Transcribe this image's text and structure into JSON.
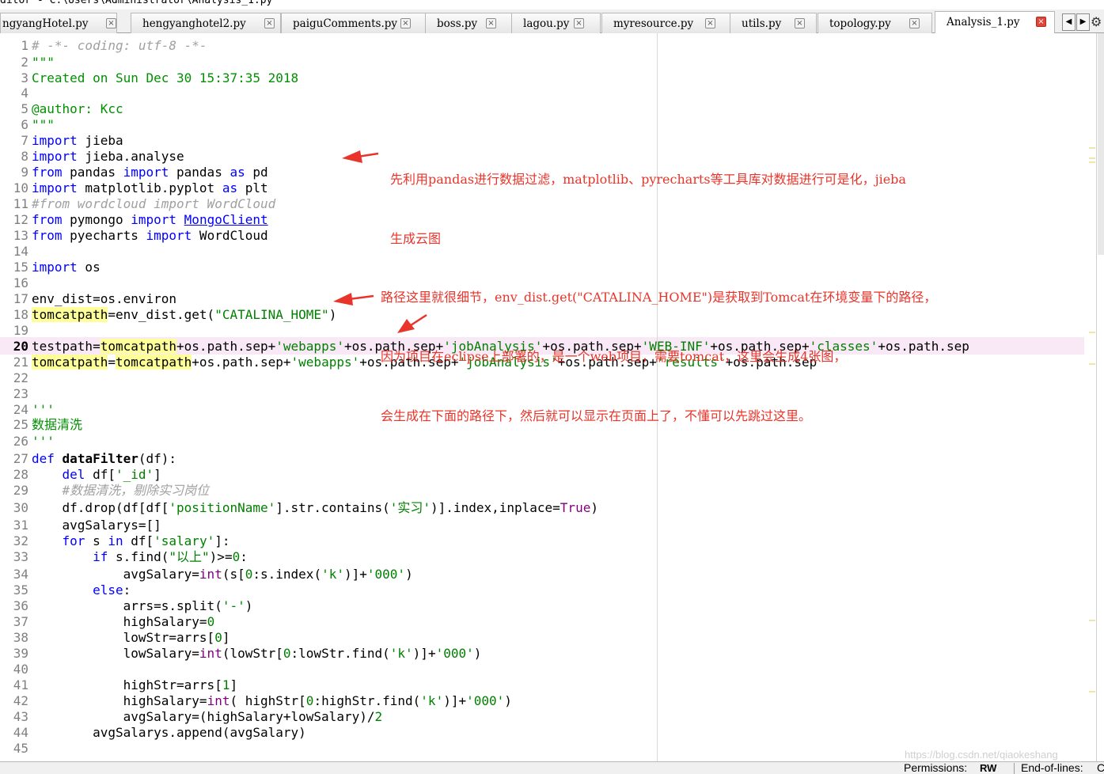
{
  "window": {
    "title": "ditor - C:\\Users\\Administrator\\Analysis_1.py"
  },
  "tabs": [
    {
      "label": "ngyangHotel.py"
    },
    {
      "label": "hengyanghotel2.py"
    },
    {
      "label": "paiguComments.py"
    },
    {
      "label": "boss.py"
    },
    {
      "label": "lagou.py"
    },
    {
      "label": "myresource.py"
    },
    {
      "label": "utils.py"
    },
    {
      "label": "topology.py"
    },
    {
      "label": "Analysis_1.py",
      "active": true
    }
  ],
  "tab_close_glyph": "×",
  "nav": {
    "left": "◀",
    "right": "▶",
    "settings": "⚙"
  },
  "editor": {
    "current_line": 20,
    "lines": [
      [
        [
          "c",
          "# -*- coding: utf-8 -*-"
        ]
      ],
      [
        [
          "sd",
          "\"\"\""
        ]
      ],
      [
        [
          "sd",
          "Created on Sun Dec 30 15:37:35 2018"
        ]
      ],
      [],
      [
        [
          "sd",
          "@author: Kcc"
        ]
      ],
      [
        [
          "sd",
          "\"\"\""
        ]
      ],
      [
        [
          "k",
          "import"
        ],
        [
          "n",
          " jieba"
        ]
      ],
      [
        [
          "k",
          "import"
        ],
        [
          "n",
          " jieba.analyse"
        ]
      ],
      [
        [
          "k",
          "from"
        ],
        [
          "n",
          " pandas "
        ],
        [
          "k",
          "import"
        ],
        [
          "n",
          " pandas "
        ],
        [
          "k",
          "as"
        ],
        [
          "n",
          " pd"
        ]
      ],
      [
        [
          "k",
          "import"
        ],
        [
          "n",
          " matplotlib.pyplot "
        ],
        [
          "k",
          "as"
        ],
        [
          "n",
          " plt"
        ]
      ],
      [
        [
          "c",
          "#from wordcloud import WordCloud"
        ]
      ],
      [
        [
          "k",
          "from"
        ],
        [
          "n",
          " pymongo "
        ],
        [
          "k",
          "import"
        ],
        [
          "n",
          " "
        ],
        [
          "u",
          "MongoClient"
        ]
      ],
      [
        [
          "k",
          "from"
        ],
        [
          "n",
          " pyecharts "
        ],
        [
          "k",
          "import"
        ],
        [
          "n",
          " WordCloud"
        ]
      ],
      [],
      [
        [
          "k",
          "import"
        ],
        [
          "n",
          " os"
        ]
      ],
      [],
      [
        [
          "n",
          "env_dist=os.environ"
        ]
      ],
      [
        [
          "hl",
          "tomcatpath"
        ],
        [
          "n",
          "=env_dist.get("
        ],
        [
          "s",
          "\"CATALINA_HOME\""
        ],
        [
          "n",
          ")"
        ]
      ],
      [],
      [
        [
          "n",
          "testpath="
        ],
        [
          "hl",
          "tomcatpath"
        ],
        [
          "n",
          "+os.path.sep+"
        ],
        [
          "s",
          "'webapps'"
        ],
        [
          "n",
          "+os.path.sep+"
        ],
        [
          "s",
          "'jobAnalysis'"
        ],
        [
          "n",
          "+os.path.sep+"
        ],
        [
          "s",
          "'WEB-INF'"
        ],
        [
          "n",
          "+os.path.sep+"
        ],
        [
          "s",
          "'classes'"
        ],
        [
          "n",
          "+os.path.sep"
        ]
      ],
      [
        [
          "hl",
          "tomcatpath"
        ],
        [
          "n",
          "="
        ],
        [
          "hl",
          "tomcatpath"
        ],
        [
          "n",
          "+os.path.sep+"
        ],
        [
          "s",
          "'webapps'"
        ],
        [
          "n",
          "+os.path.sep+"
        ],
        [
          "s",
          "'jobAnalysis'"
        ],
        [
          "n",
          "+os.path.sep+"
        ],
        [
          "s",
          "'results'"
        ],
        [
          "n",
          "+os.path.sep"
        ]
      ],
      [],
      [],
      [
        [
          "sd",
          "'''"
        ]
      ],
      [
        [
          "sd",
          "数据清洗"
        ]
      ],
      [
        [
          "sd",
          "'''"
        ]
      ],
      [
        [
          "k",
          "def"
        ],
        [
          "n",
          " "
        ],
        [
          "fn",
          "dataFilter"
        ],
        [
          "n",
          "(df):"
        ]
      ],
      [
        [
          "n",
          "    "
        ],
        [
          "k",
          "del"
        ],
        [
          "n",
          " df["
        ],
        [
          "s",
          "'_id'"
        ],
        [
          "n",
          "]"
        ]
      ],
      [
        [
          "n",
          "    "
        ],
        [
          "c",
          "#数据清洗，剔除实习岗位"
        ]
      ],
      [
        [
          "n",
          "    df.drop(df[df["
        ],
        [
          "s",
          "'positionName'"
        ],
        [
          "n",
          "].str.contains("
        ],
        [
          "s",
          "'实习'"
        ],
        [
          "n",
          ")].index,inplace="
        ],
        [
          "bi",
          "True"
        ],
        [
          "n",
          ")"
        ]
      ],
      [
        [
          "n",
          "    avgSalarys=[]"
        ]
      ],
      [
        [
          "n",
          "    "
        ],
        [
          "k",
          "for"
        ],
        [
          "n",
          " s "
        ],
        [
          "k",
          "in"
        ],
        [
          "n",
          " df["
        ],
        [
          "s",
          "'salary'"
        ],
        [
          "n",
          "]:"
        ]
      ],
      [
        [
          "n",
          "        "
        ],
        [
          "k",
          "if"
        ],
        [
          "n",
          " s.find("
        ],
        [
          "s",
          "\"以上\""
        ],
        [
          "n",
          ")>="
        ],
        [
          "s",
          "0"
        ],
        [
          "n",
          ":"
        ]
      ],
      [
        [
          "n",
          "            avgSalary="
        ],
        [
          "bi",
          "int"
        ],
        [
          "n",
          "(s["
        ],
        [
          "s",
          "0"
        ],
        [
          "n",
          ":s.index("
        ],
        [
          "s",
          "'k'"
        ],
        [
          "n",
          ")]+"
        ],
        [
          "s",
          "'000'"
        ],
        [
          "n",
          ")"
        ]
      ],
      [
        [
          "n",
          "        "
        ],
        [
          "k",
          "else"
        ],
        [
          "n",
          ":"
        ]
      ],
      [
        [
          "n",
          "            arrs=s.split("
        ],
        [
          "s",
          "'-'"
        ],
        [
          "n",
          ")"
        ]
      ],
      [
        [
          "n",
          "            highSalary="
        ],
        [
          "s",
          "0"
        ]
      ],
      [
        [
          "n",
          "            lowStr=arrs["
        ],
        [
          "s",
          "0"
        ],
        [
          "n",
          "]"
        ]
      ],
      [
        [
          "n",
          "            lowSalary="
        ],
        [
          "bi",
          "int"
        ],
        [
          "n",
          "(lowStr["
        ],
        [
          "s",
          "0"
        ],
        [
          "n",
          ":lowStr.find("
        ],
        [
          "s",
          "'k'"
        ],
        [
          "n",
          ")]+"
        ],
        [
          "s",
          "'000'"
        ],
        [
          "n",
          ")"
        ]
      ],
      [],
      [
        [
          "n",
          "            highStr=arrs["
        ],
        [
          "s",
          "1"
        ],
        [
          "n",
          "]"
        ]
      ],
      [
        [
          "n",
          "            highSalary="
        ],
        [
          "bi",
          "int"
        ],
        [
          "n",
          "( highStr["
        ],
        [
          "s",
          "0"
        ],
        [
          "n",
          ":highStr.find("
        ],
        [
          "s",
          "'k'"
        ],
        [
          "n",
          ")]+"
        ],
        [
          "s",
          "'000'"
        ],
        [
          "n",
          ")"
        ]
      ],
      [
        [
          "n",
          "            avgSalary=(highSalary+lowSalary)/"
        ],
        [
          "s",
          "2"
        ]
      ],
      [
        [
          "n",
          "        avgSalarys.append(avgSalary)"
        ]
      ],
      []
    ]
  },
  "annotations": [
    {
      "lines": [
        "先利用pandas进行数据过滤，matplotlib、pyrecharts等工具库对数据进行可是化，jieba",
        "生成云图"
      ]
    },
    {
      "lines": [
        "路径这里就很细节，env_dist.get(\"CATALINA_HOME\")是获取到Tomcat在环境变量下的路径，",
        "因为项目在eclipse上部署的，是一个web项目，需要tomcat，这里会生成4张图，",
        "会生成在下面的路径下，然后就可以显示在页面上了，不懂可以先跳过这里。"
      ]
    }
  ],
  "status": {
    "permissions_label": "Permissions:",
    "permissions_value": "RW",
    "eol_label": "End-of-lines:",
    "eol_value": "C"
  },
  "watermark": "https://blog.csdn.net/qiaokeshang"
}
